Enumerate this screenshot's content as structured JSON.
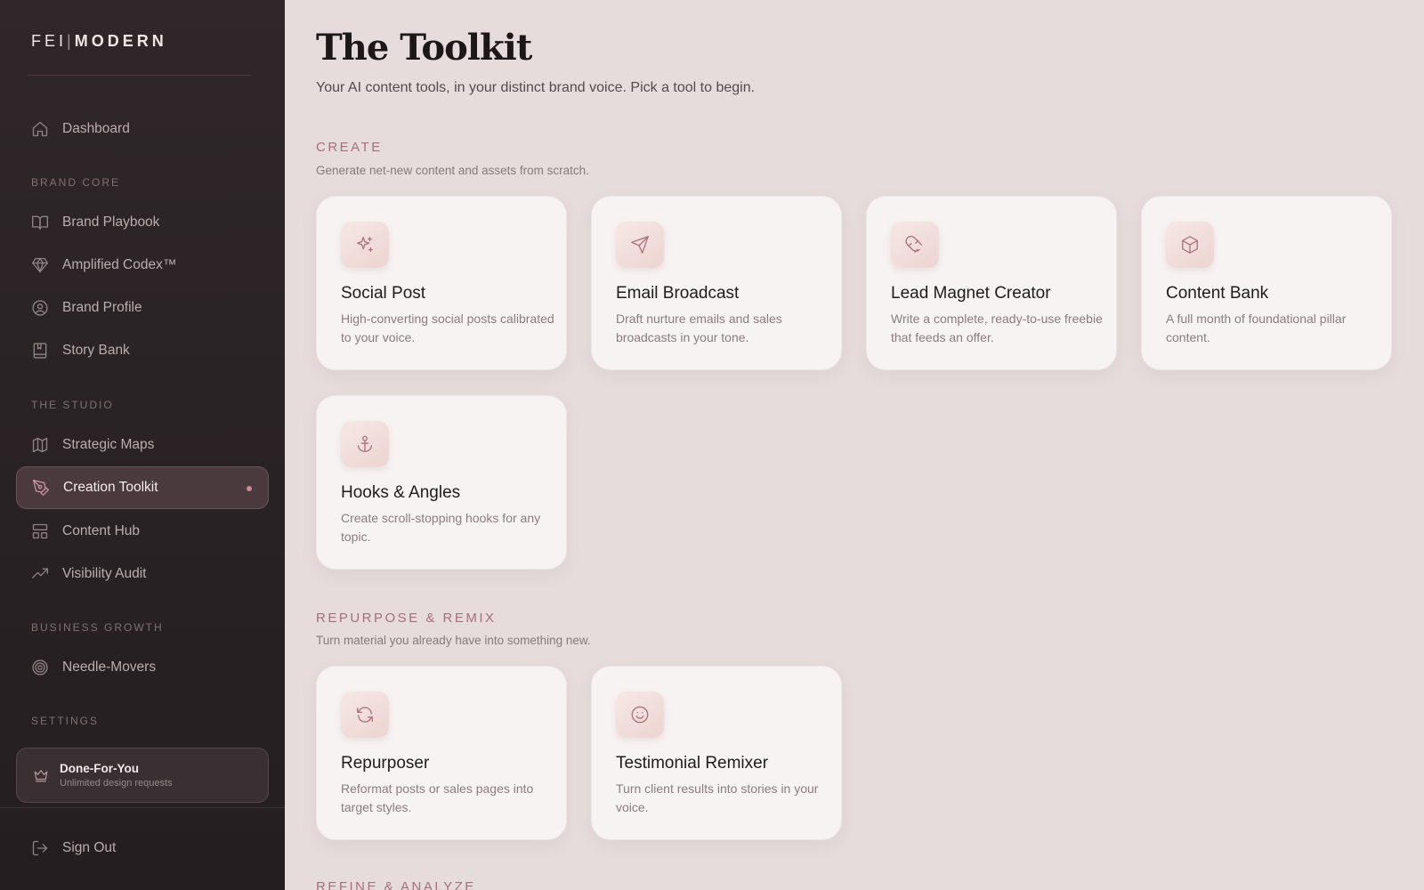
{
  "sidebar": {
    "logo_left": "FEI",
    "logo_sep": "|",
    "logo_right": "MODERN",
    "dashboard": "Dashboard",
    "sections": {
      "brand_core": "BRAND CORE",
      "the_studio": "THE STUDIO",
      "business_growth": "BUSINESS GROWTH",
      "settings": "SETTINGS"
    },
    "brand_core_items": [
      {
        "label": "Brand Playbook",
        "icon": "book-open-icon"
      },
      {
        "label": "Amplified Codex™",
        "icon": "gem-icon"
      },
      {
        "label": "Brand Profile",
        "icon": "user-circle-icon"
      },
      {
        "label": "Story Bank",
        "icon": "notebook-icon"
      }
    ],
    "studio_items": [
      {
        "label": "Strategic Maps",
        "icon": "map-icon"
      },
      {
        "label": "Creation Toolkit",
        "icon": "pen-tool-icon",
        "active": true
      },
      {
        "label": "Content Hub",
        "icon": "layout-icon"
      },
      {
        "label": "Visibility Audit",
        "icon": "trending-up-icon"
      }
    ],
    "growth_items": [
      {
        "label": "Needle-Movers",
        "icon": "target-icon"
      }
    ],
    "done_for_you": {
      "title": "Done-For-You",
      "subtitle": "Unlimited design requests",
      "icon": "crown-icon"
    },
    "sign_out": "Sign Out"
  },
  "main": {
    "title": "The Toolkit",
    "subtitle": "Your AI content tools, in your distinct brand voice. Pick a tool to begin.",
    "sections": [
      {
        "heading": "CREATE",
        "description": "Generate net-new content and assets from scratch.",
        "tools": [
          {
            "title": "Social Post",
            "desc": "High-converting social posts calibrated to your voice.",
            "icon": "sparkles-icon"
          },
          {
            "title": "Email Broadcast",
            "desc": "Draft nurture emails and sales broadcasts in your tone.",
            "icon": "send-icon"
          },
          {
            "title": "Lead Magnet Creator",
            "desc": "Write a complete, ready-to-use freebie that feeds an offer.",
            "icon": "magnet-icon"
          },
          {
            "title": "Content Bank",
            "desc": "A full month of foundational pillar content.",
            "icon": "box-icon"
          },
          {
            "title": "Hooks & Angles",
            "desc": "Create scroll-stopping hooks for any topic.",
            "icon": "anchor-icon"
          }
        ]
      },
      {
        "heading": "REPURPOSE & REMIX",
        "description": "Turn material you already have into something new.",
        "tools": [
          {
            "title": "Repurposer",
            "desc": "Reformat posts or sales pages into target styles.",
            "icon": "refresh-icon"
          },
          {
            "title": "Testimonial Remixer",
            "desc": "Turn client results into stories in your voice.",
            "icon": "smile-icon"
          }
        ]
      },
      {
        "heading": "REFINE & ANALYZE"
      }
    ]
  },
  "colors": {
    "sidebar_bg": "#2a2325",
    "main_bg": "#e6dcdb",
    "accent": "#a4707c",
    "card_bg": "#f7f3f2"
  }
}
